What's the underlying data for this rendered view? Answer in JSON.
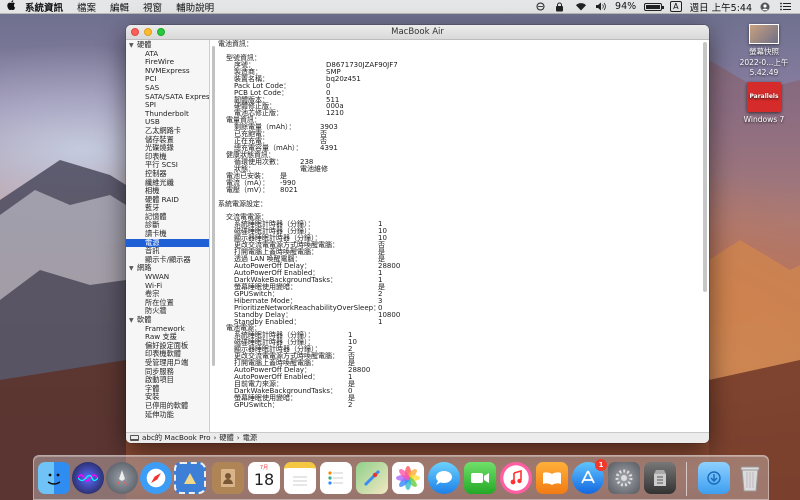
{
  "menubar": {
    "app_name": "系統資訊",
    "menus": [
      "檔案",
      "編輯",
      "視窗",
      "輔助說明"
    ],
    "battery_percent": "94%",
    "input_method": "A",
    "clock": "週日 上午5:44"
  },
  "window": {
    "title": "MacBook Air"
  },
  "sidebar": [
    {
      "type": "cat",
      "label": "硬體"
    },
    {
      "type": "item",
      "label": "ATA"
    },
    {
      "type": "item",
      "label": "FireWire"
    },
    {
      "type": "item",
      "label": "NVMExpress"
    },
    {
      "type": "item",
      "label": "PCI"
    },
    {
      "type": "item",
      "label": "SAS"
    },
    {
      "type": "item",
      "label": "SATA/SATA Express"
    },
    {
      "type": "item",
      "label": "SPI"
    },
    {
      "type": "item",
      "label": "Thunderbolt"
    },
    {
      "type": "item",
      "label": "USB"
    },
    {
      "type": "item",
      "label": "乙太網路卡"
    },
    {
      "type": "item",
      "label": "儲存裝置"
    },
    {
      "type": "item",
      "label": "光碟燒錄"
    },
    {
      "type": "item",
      "label": "印表機"
    },
    {
      "type": "item",
      "label": "平行 SCSI"
    },
    {
      "type": "item",
      "label": "控制器"
    },
    {
      "type": "item",
      "label": "纖維光纖"
    },
    {
      "type": "item",
      "label": "相機"
    },
    {
      "type": "item",
      "label": "硬體 RAID"
    },
    {
      "type": "item",
      "label": "藍牙"
    },
    {
      "type": "item",
      "label": "記憶體"
    },
    {
      "type": "item",
      "label": "診斷"
    },
    {
      "type": "item",
      "label": "讀卡機"
    },
    {
      "type": "item",
      "label": "電源",
      "selected": true
    },
    {
      "type": "item",
      "label": "音訊"
    },
    {
      "type": "item",
      "label": "顯示卡/顯示器"
    },
    {
      "type": "cat",
      "label": "網路"
    },
    {
      "type": "item",
      "label": "WWAN"
    },
    {
      "type": "item",
      "label": "Wi-Fi"
    },
    {
      "type": "item",
      "label": "卷宗"
    },
    {
      "type": "item",
      "label": "所在位置"
    },
    {
      "type": "item",
      "label": "防火牆"
    },
    {
      "type": "cat",
      "label": "軟體"
    },
    {
      "type": "item",
      "label": "Framework"
    },
    {
      "type": "item",
      "label": "Raw 支援"
    },
    {
      "type": "item",
      "label": "偏好設定面板"
    },
    {
      "type": "item",
      "label": "印表機軟體"
    },
    {
      "type": "item",
      "label": "受管理用戶端"
    },
    {
      "type": "item",
      "label": "同步服務"
    },
    {
      "type": "item",
      "label": "啟動項目"
    },
    {
      "type": "item",
      "label": "字體"
    },
    {
      "type": "item",
      "label": "安裝"
    },
    {
      "type": "item",
      "label": "已停用的軟體"
    },
    {
      "type": "item",
      "label": "延伸功能"
    }
  ],
  "content": [
    {
      "indent": 0,
      "k": "電池資訊："
    },
    {
      "indent": 0,
      "k": ""
    },
    {
      "indent": 1,
      "k": "型號資訊："
    },
    {
      "indent": 2,
      "k": "序號：",
      "v": "D8671730JZAF90JF7",
      "vcol": 1
    },
    {
      "indent": 2,
      "k": "製造商：",
      "v": "SMP",
      "vcol": 1
    },
    {
      "indent": 2,
      "k": "裝置名稱：",
      "v": "bq20z451",
      "vcol": 1
    },
    {
      "indent": 2,
      "k": "Pack Lot Code：",
      "v": "0",
      "vcol": 1
    },
    {
      "indent": 2,
      "k": "PCB Lot Code：",
      "v": "0",
      "vcol": 1
    },
    {
      "indent": 2,
      "k": "韌體版本：",
      "v": "511",
      "vcol": 1
    },
    {
      "indent": 2,
      "k": "硬體修正版：",
      "v": "000a",
      "vcol": 1
    },
    {
      "indent": 2,
      "k": "電池芯修正版：",
      "v": "1210",
      "vcol": 1
    },
    {
      "indent": 1,
      "k": "電量資訊："
    },
    {
      "indent": 2,
      "k": "剩餘電量（mAh）：",
      "v": "3903",
      "vcol": 2
    },
    {
      "indent": 2,
      "k": "已充飽電：",
      "v": "否",
      "vcol": 2
    },
    {
      "indent": 2,
      "k": "正在充電：",
      "v": "否",
      "vcol": 2
    },
    {
      "indent": 2,
      "k": "總充電容量（mAh）：",
      "v": "4391",
      "vcol": 2
    },
    {
      "indent": 1,
      "k": "健康狀態資訊："
    },
    {
      "indent": 2,
      "k": "循環使用次數：",
      "v": "238",
      "vcol": 3
    },
    {
      "indent": 2,
      "k": "狀態：",
      "v": "電池維修",
      "vcol": 3
    },
    {
      "indent": 1,
      "k": "電池已安裝：",
      "v": "是",
      "vcol": 4
    },
    {
      "indent": 1,
      "k": "電流（mA）：",
      "v": "-990",
      "vcol": 4
    },
    {
      "indent": 1,
      "k": "電壓（mV）：",
      "v": "8021",
      "vcol": 4
    },
    {
      "indent": 0,
      "k": ""
    },
    {
      "indent": 0,
      "k": "系統電源設定："
    },
    {
      "indent": 0,
      "k": ""
    },
    {
      "indent": 1,
      "k": "交流電電源："
    },
    {
      "indent": 2,
      "k": "系統睡眠計時器（分鐘）：",
      "v": "1",
      "vcol": 5
    },
    {
      "indent": 2,
      "k": "磁碟睡眠計時器（分鐘）：",
      "v": "10",
      "vcol": 5
    },
    {
      "indent": 2,
      "k": "顯示器睡眠計時器（分鐘）：",
      "v": "10",
      "vcol": 5
    },
    {
      "indent": 2,
      "k": "更改交流電電源方式時喚醒電腦：",
      "v": "否",
      "vcol": 5
    },
    {
      "indent": 2,
      "k": "打開電腦上蓋時喚醒電腦：",
      "v": "是",
      "vcol": 5
    },
    {
      "indent": 2,
      "k": "透過 LAN 喚醒電腦：",
      "v": "是",
      "vcol": 5
    },
    {
      "indent": 2,
      "k": "AutoPowerOff Delay：",
      "v": "28800",
      "vcol": 5
    },
    {
      "indent": 2,
      "k": "AutoPowerOff Enabled：",
      "v": "1",
      "vcol": 5
    },
    {
      "indent": 2,
      "k": "DarkWakeBackgroundTasks：",
      "v": "1",
      "vcol": 5
    },
    {
      "indent": 2,
      "k": "螢幕睡眠使用變暗：",
      "v": "是",
      "vcol": 5
    },
    {
      "indent": 2,
      "k": "GPUSwitch：",
      "v": "2",
      "vcol": 5
    },
    {
      "indent": 2,
      "k": "Hibernate Mode：",
      "v": "3",
      "vcol": 5
    },
    {
      "indent": 2,
      "k": "PrioritizeNetworkReachabilityOverSleep：",
      "v": "0",
      "vcol": 5
    },
    {
      "indent": 2,
      "k": "Standby Delay：",
      "v": "10800",
      "vcol": 5
    },
    {
      "indent": 2,
      "k": "Standby Enabled：",
      "v": "1",
      "vcol": 5
    },
    {
      "indent": 1,
      "k": "電池電源："
    },
    {
      "indent": 2,
      "k": "系統睡眠計時器（分鐘）：",
      "v": "1",
      "vcol": 6
    },
    {
      "indent": 2,
      "k": "磁碟睡眠計時器（分鐘）：",
      "v": "10",
      "vcol": 6
    },
    {
      "indent": 2,
      "k": "顯示器睡眠計時器（分鐘）：",
      "v": "2",
      "vcol": 6
    },
    {
      "indent": 2,
      "k": "更改交流電電源方式時喚醒電腦：",
      "v": "否",
      "vcol": 6
    },
    {
      "indent": 2,
      "k": "打開電腦上蓋時喚醒電腦：",
      "v": "是",
      "vcol": 6
    },
    {
      "indent": 2,
      "k": "AutoPowerOff Delay：",
      "v": "28800",
      "vcol": 6
    },
    {
      "indent": 2,
      "k": "AutoPowerOff Enabled：",
      "v": "1",
      "vcol": 6
    },
    {
      "indent": 2,
      "k": "目前電力來源：",
      "v": "是",
      "vcol": 6
    },
    {
      "indent": 2,
      "k": "DarkWakeBackgroundTasks：",
      "v": "0",
      "vcol": 6
    },
    {
      "indent": 2,
      "k": "螢幕睡眠使用變暗：",
      "v": "是",
      "vcol": 6
    },
    {
      "indent": 2,
      "k": "GPUSwitch：",
      "v": "2",
      "vcol": 6
    }
  ],
  "pathbar": {
    "computer": "abc的 MacBook Pro",
    "sep1": "›",
    "section": "硬體",
    "sep2": "›",
    "leaf": "電源"
  },
  "desktop": {
    "screenshot_label_1": "螢幕快照",
    "screenshot_label_2": "2022-0...上午5.42.49",
    "parallels_box_text": "Parallels",
    "parallels_label": "Windows 7"
  },
  "dock": {
    "calendar_month": "7月",
    "calendar_day": "18",
    "appstore_badge": "1"
  }
}
